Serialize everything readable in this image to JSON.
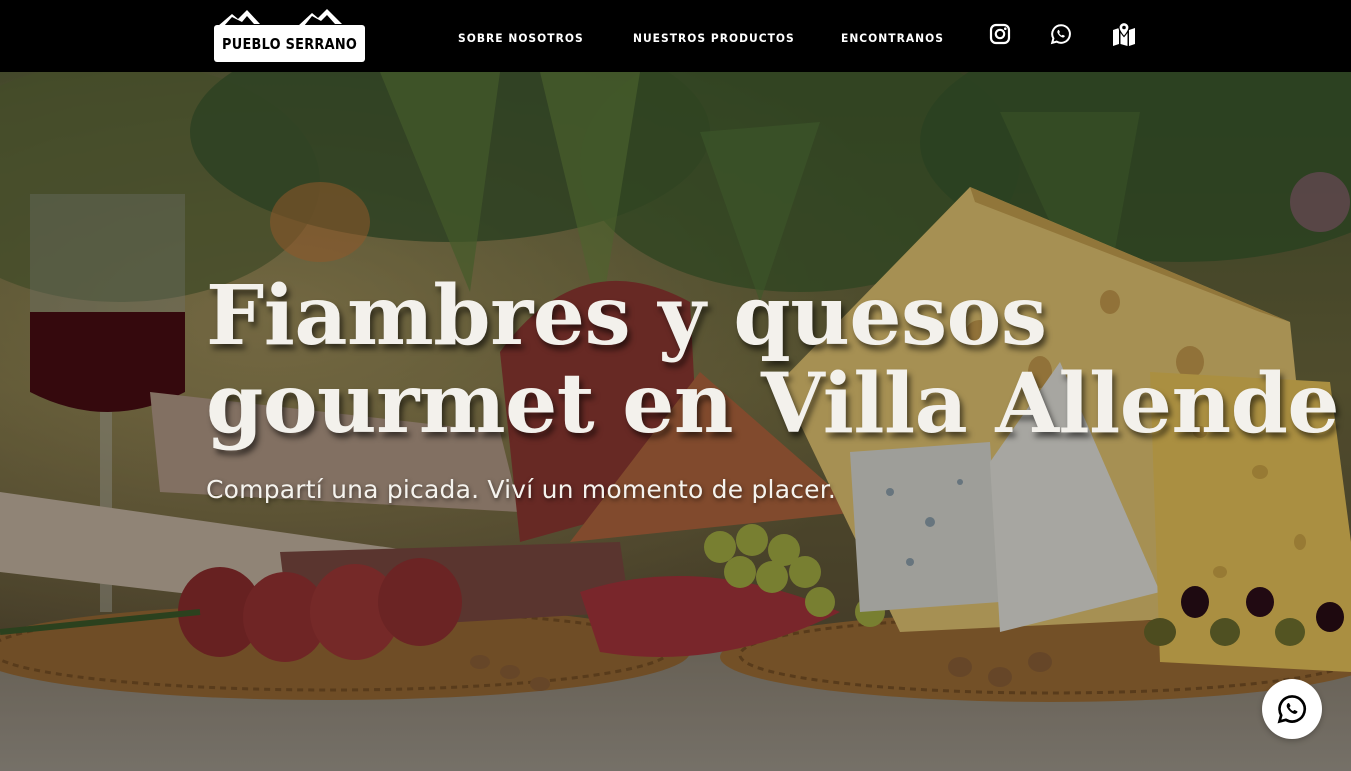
{
  "brand": {
    "logo_text": "PUEBLO SERRANO"
  },
  "nav": {
    "items": [
      {
        "label": "SOBRE NOSOTROS"
      },
      {
        "label": "NUESTROS PRODUCTOS"
      },
      {
        "label": "ENCONTRANOS"
      }
    ],
    "icons": [
      "instagram-icon",
      "whatsapp-icon",
      "map-icon"
    ]
  },
  "hero": {
    "title_line1": "Fiambres y quesos",
    "title_line2": "gourmet en Villa Allende",
    "subtitle": "Compartí una picada. Viví un momento de placer."
  },
  "floating_button": {
    "icon": "whatsapp-icon"
  },
  "colors": {
    "header_bg": "#000000",
    "header_text": "#ffffff",
    "hero_text": "#f3f1ec",
    "float_button_bg": "#ffffff"
  }
}
